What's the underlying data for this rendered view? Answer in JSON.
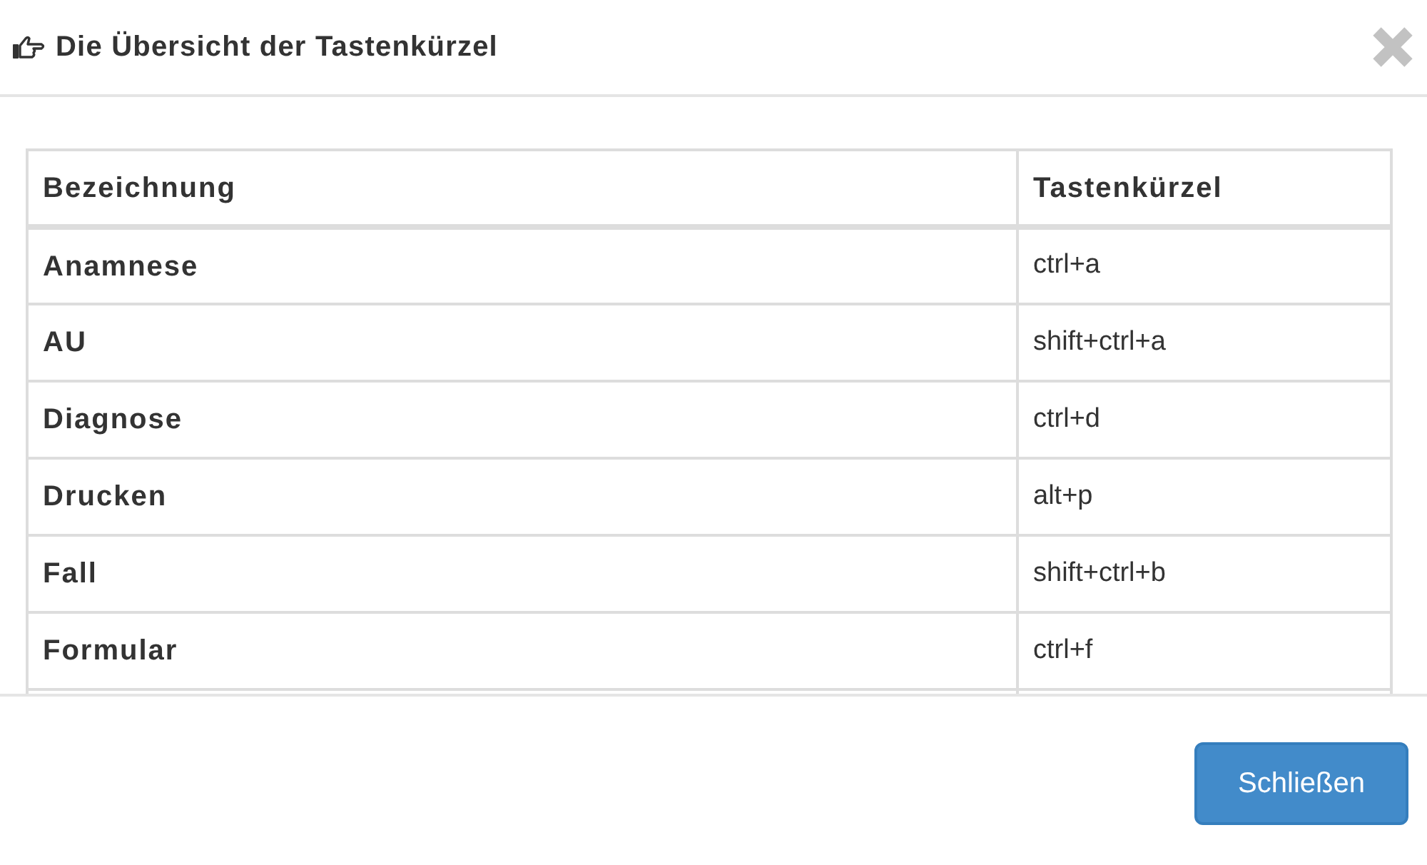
{
  "dialog": {
    "title": "Die Übersicht der Tastenkürzel"
  },
  "table": {
    "columns": [
      "Bezeichnung",
      "Tastenkürzel"
    ],
    "rows": [
      [
        "Anamnese",
        "ctrl+a"
      ],
      [
        "AU",
        "shift+ctrl+a"
      ],
      [
        "Diagnose",
        "ctrl+d"
      ],
      [
        "Drucken",
        "alt+p"
      ],
      [
        "Fall",
        "shift+ctrl+b"
      ],
      [
        "Formular",
        "ctrl+f"
      ]
    ]
  },
  "buttons": [
    "Schließen"
  ]
}
